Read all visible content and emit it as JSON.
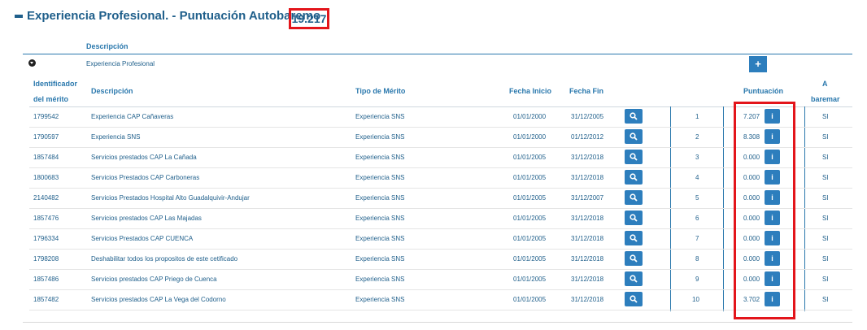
{
  "section": {
    "title": "Experiencia Profesional. - Puntuación Autobaremo",
    "score": "19.217"
  },
  "group": {
    "header": "Descripción",
    "name": "Experiencia Profesional",
    "add_label": "+"
  },
  "columns": {
    "id_line1": "Identificador",
    "id_line2": "del mérito",
    "descripcion": "Descripción",
    "tipo": "Tipo de Mérito",
    "fecha_inicio": "Fecha Inicio",
    "fecha_fin": "Fecha Fin",
    "puntuacion": "Puntuación",
    "a_baremar_line1": "A",
    "a_baremar_line2": "baremar"
  },
  "info_label": "i",
  "rows": [
    {
      "id": "1799542",
      "desc": "Experiencia CAP Cañaveras",
      "tipo": "Experiencia SNS",
      "inicio": "01/01/2000",
      "fin": "31/12/2005",
      "num": "1",
      "punt": "7.207",
      "baremar": "SI"
    },
    {
      "id": "1790597",
      "desc": "Experiencia SNS",
      "tipo": "Experiencia SNS",
      "inicio": "01/01/2000",
      "fin": "01/12/2012",
      "num": "2",
      "punt": "8.308",
      "baremar": "SI"
    },
    {
      "id": "1857484",
      "desc": "Servicios prestados CAP La Cañada",
      "tipo": "Experiencia SNS",
      "inicio": "01/01/2005",
      "fin": "31/12/2018",
      "num": "3",
      "punt": "0.000",
      "baremar": "SI"
    },
    {
      "id": "1800683",
      "desc": "Servicios Prestados CAP Carboneras",
      "tipo": "Experiencia SNS",
      "inicio": "01/01/2005",
      "fin": "31/12/2018",
      "num": "4",
      "punt": "0.000",
      "baremar": "SI"
    },
    {
      "id": "2140482",
      "desc": "Servicios Prestados Hospital Alto Guadalquivir-Andujar",
      "tipo": "Experiencia SNS",
      "inicio": "01/01/2005",
      "fin": "31/12/2007",
      "num": "5",
      "punt": "0.000",
      "baremar": "SI"
    },
    {
      "id": "1857476",
      "desc": "Servicios prestados CAP Las Majadas",
      "tipo": "Experiencia SNS",
      "inicio": "01/01/2005",
      "fin": "31/12/2018",
      "num": "6",
      "punt": "0.000",
      "baremar": "SI"
    },
    {
      "id": "1796334",
      "desc": "Servicios Prestados CAP CUENCA",
      "tipo": "Experiencia SNS",
      "inicio": "01/01/2005",
      "fin": "31/12/2018",
      "num": "7",
      "punt": "0.000",
      "baremar": "SI"
    },
    {
      "id": "1798208",
      "desc": "Deshabilitar todos los propositos de este cetificado",
      "tipo": "Experiencia SNS",
      "inicio": "01/01/2005",
      "fin": "31/12/2018",
      "num": "8",
      "punt": "0.000",
      "baremar": "SI"
    },
    {
      "id": "1857486",
      "desc": "Servicios prestados CAP Priego de Cuenca",
      "tipo": "Experiencia SNS",
      "inicio": "01/01/2005",
      "fin": "31/12/2018",
      "num": "9",
      "punt": "0.000",
      "baremar": "SI"
    },
    {
      "id": "1857482",
      "desc": "Servicios prestados CAP La Vega del Codorno",
      "tipo": "Experiencia SNS",
      "inicio": "01/01/2005",
      "fin": "31/12/2018",
      "num": "10",
      "punt": "3.702",
      "baremar": "SI"
    }
  ],
  "colors": {
    "accent": "#2d7ebd",
    "text": "#1f5f8b",
    "highlight": "#e3151b"
  },
  "icons": {
    "row_action": "search-icon",
    "collapse": "minus-icon",
    "expand_group": "chevron-down-circle-icon"
  }
}
